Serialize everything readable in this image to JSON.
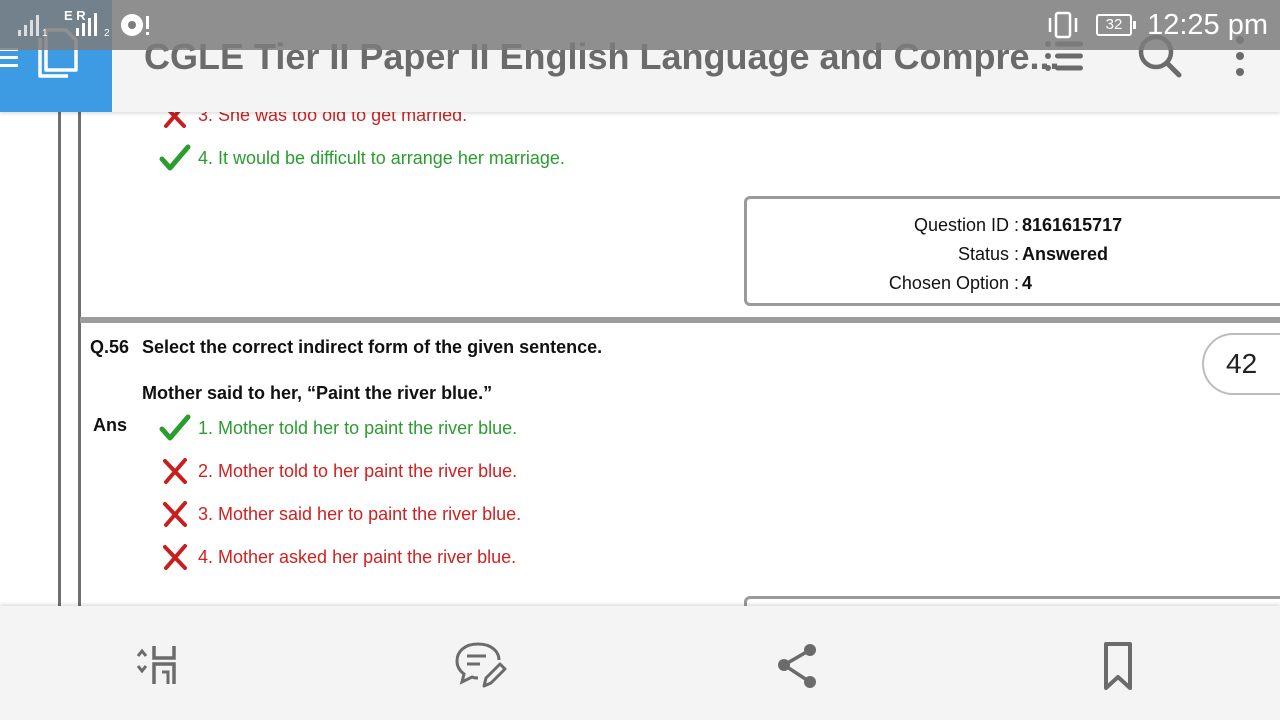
{
  "status_bar": {
    "carrier_letters": "E R",
    "sim1": "1",
    "sim2": "2",
    "battery": "32",
    "time": "12:25 pm"
  },
  "header": {
    "title": "CGLE Tier II Paper II English Language and Compre..."
  },
  "prev_question": {
    "options": [
      {
        "text": "3. She was too old to get married.",
        "correct": false
      },
      {
        "text": "4. It would be difficult to arrange her marriage.",
        "correct": true
      }
    ],
    "info": {
      "question_id_label": "Question ID :",
      "question_id": "8161615717",
      "status_label": "Status :",
      "status": "Answered",
      "chosen_label": "Chosen Option :",
      "chosen": "4"
    }
  },
  "question": {
    "number": "Q.56",
    "text": "Select the correct indirect form of the given sentence.",
    "sentence": "Mother said to her, “Paint the river blue.”",
    "ans_label": "Ans",
    "options": [
      {
        "text": "1. Mother told her to paint the river blue.",
        "correct": true
      },
      {
        "text": "2. Mother told to her paint the river blue.",
        "correct": false
      },
      {
        "text": "3. Mother said her to paint the river blue.",
        "correct": false
      },
      {
        "text": "4. Mother asked her paint the river blue.",
        "correct": false
      }
    ]
  },
  "page_indicator": "42",
  "bottom_bar": {
    "icons": [
      "fit-page-icon",
      "comment-icon",
      "share-icon",
      "bookmark-icon"
    ]
  },
  "colors": {
    "accent": "#3d9be4",
    "correct": "#2a9d2f",
    "wrong": "#d21f1f"
  }
}
